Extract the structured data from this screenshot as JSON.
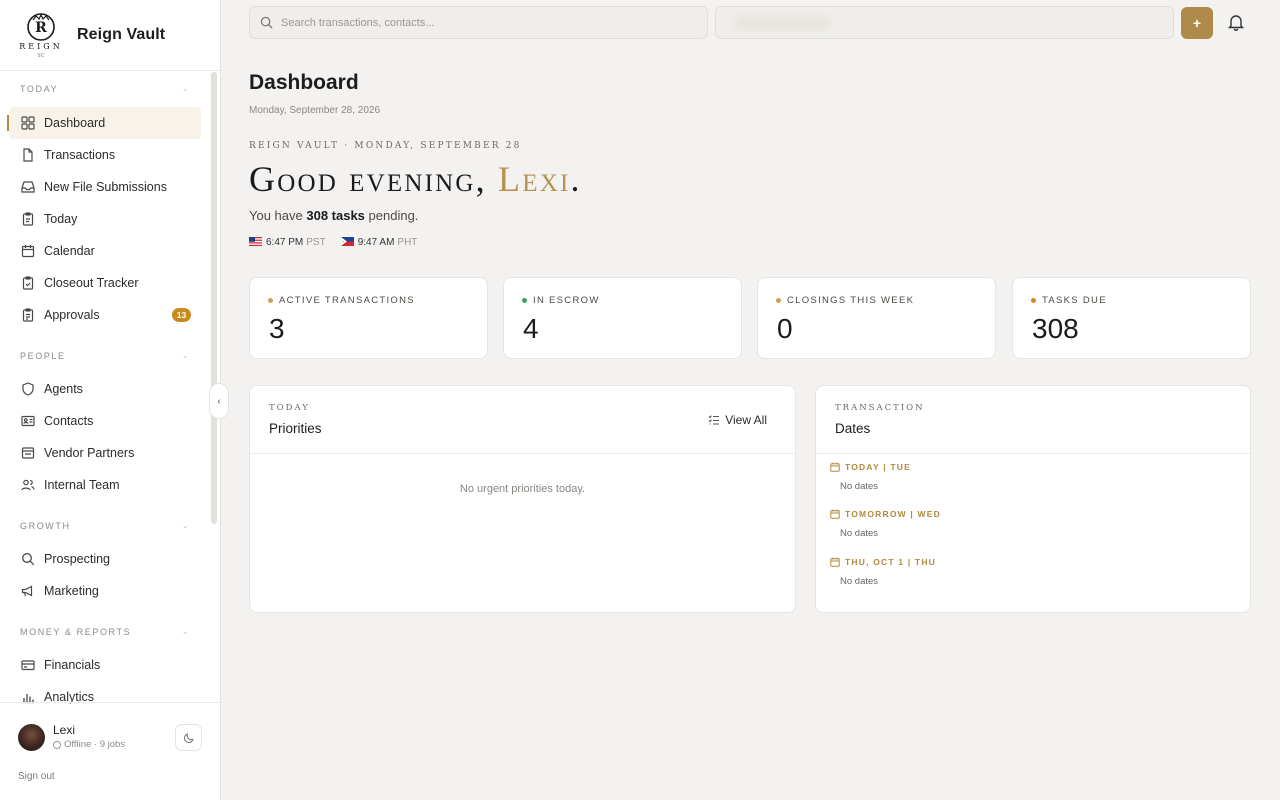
{
  "brand": {
    "name": "Reign Vault",
    "logo_text": "REIGN",
    "logo_sub": "TC"
  },
  "sidebar": {
    "sections": [
      {
        "label": "Today",
        "items": [
          {
            "label": "Dashboard",
            "icon": "grid-icon",
            "active": true
          },
          {
            "label": "Transactions",
            "icon": "file-icon"
          },
          {
            "label": "New File Submissions",
            "icon": "inbox-icon"
          },
          {
            "label": "Today",
            "icon": "clipboard-icon"
          },
          {
            "label": "Calendar",
            "icon": "calendar-icon"
          },
          {
            "label": "Closeout Tracker",
            "icon": "clipboard-check-icon"
          },
          {
            "label": "Approvals",
            "icon": "clipboard-list-icon",
            "badge": "13"
          }
        ]
      },
      {
        "label": "People",
        "items": [
          {
            "label": "Agents",
            "icon": "shield-icon"
          },
          {
            "label": "Contacts",
            "icon": "contact-card-icon"
          },
          {
            "label": "Vendor Partners",
            "icon": "store-icon"
          },
          {
            "label": "Internal Team",
            "icon": "users-icon"
          }
        ]
      },
      {
        "label": "Growth",
        "items": [
          {
            "label": "Prospecting",
            "icon": "search-icon"
          },
          {
            "label": "Marketing",
            "icon": "megaphone-icon"
          }
        ]
      },
      {
        "label": "Money & Reports",
        "items": [
          {
            "label": "Financials",
            "icon": "credit-card-icon"
          },
          {
            "label": "Analytics",
            "icon": "bar-chart-icon"
          }
        ]
      }
    ],
    "user": {
      "name": "Lexi",
      "status": "Offline · 9 jobs"
    },
    "sign_out": "Sign out"
  },
  "topbar": {
    "search_placeholder": "Search transactions, contacts..."
  },
  "header": {
    "title": "Dashboard",
    "date": "Monday, September 28, 2026",
    "eyebrow": "Reign Vault · Monday, September 28",
    "greeting_prefix": "Good evening, ",
    "greeting_name": "Lexi",
    "greeting_suffix": ".",
    "pending_prefix": "You have ",
    "pending_count": "308 tasks",
    "pending_suffix": " pending.",
    "clock1_time": "6:47 PM",
    "clock1_tz": "PST",
    "clock2_time": "9:47 AM",
    "clock2_tz": "PHT"
  },
  "stats": [
    {
      "label": "Active Transactions",
      "value": "3",
      "dot": "#c9a35a"
    },
    {
      "label": "In Escrow",
      "value": "4",
      "dot": "#3e9b6a"
    },
    {
      "label": "Closings This Week",
      "value": "0",
      "dot": "#c9a35a"
    },
    {
      "label": "Tasks Due",
      "value": "308",
      "dot": "#d08a2a"
    }
  ],
  "priorities": {
    "kicker": "Today",
    "title": "Priorities",
    "view_all": "View All",
    "empty": "No urgent priorities today."
  },
  "dates": {
    "kicker": "Transaction",
    "title": "Dates",
    "groups": [
      {
        "heading": "Today | Tue",
        "note": "No dates"
      },
      {
        "heading": "Tomorrow | Wed",
        "note": "No dates"
      },
      {
        "heading": "Thu, Oct 1 | Thu",
        "note": "No dates"
      }
    ]
  },
  "colors": {
    "accent": "#b08a4a",
    "badge": "#c98a1c"
  }
}
